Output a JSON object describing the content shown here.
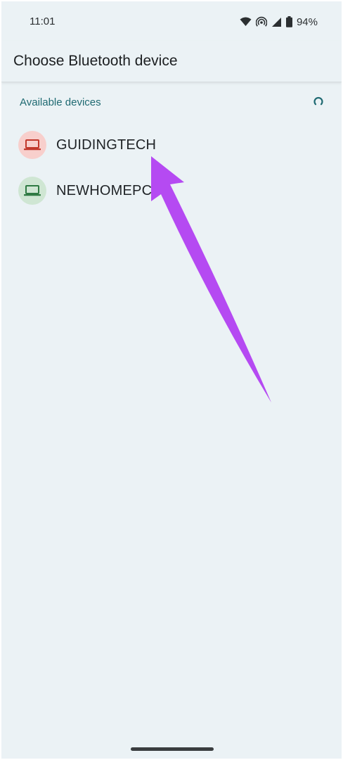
{
  "status_bar": {
    "time": "11:01",
    "battery": "94%",
    "icons": [
      "wifi-icon",
      "hotspot-icon",
      "signal-icon",
      "battery-icon"
    ]
  },
  "app_bar": {
    "title": "Choose Bluetooth device"
  },
  "section": {
    "header": "Available devices",
    "spinner_icon": "loading-spinner-icon"
  },
  "devices": [
    {
      "name": "GUIDINGTECH",
      "icon": "laptop-icon",
      "circle_color": "#f8cfcc",
      "icon_color": "#c2392d"
    },
    {
      "name": "NEWHOMEPC",
      "icon": "laptop-icon",
      "circle_color": "#cfe6d3",
      "icon_color": "#2f7a43"
    }
  ],
  "colors": {
    "background": "#ebf2f5",
    "accent_teal": "#1f6a72",
    "annotation_arrow": "#b54af2"
  },
  "annotation": {
    "icon": "pointer-arrow-icon"
  }
}
